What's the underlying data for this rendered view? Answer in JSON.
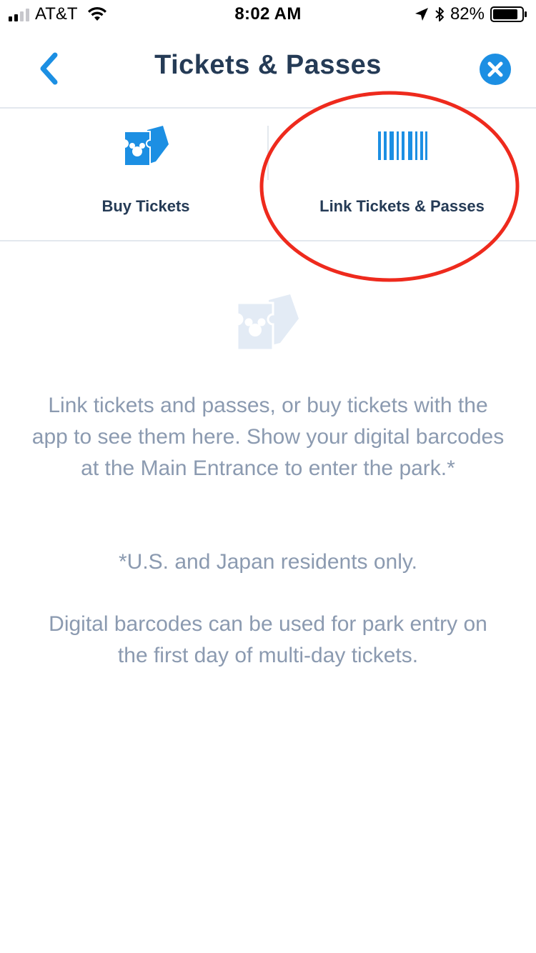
{
  "status_bar": {
    "carrier": "AT&T",
    "time": "8:02 AM",
    "battery": "82%",
    "icons": [
      "signal-icon",
      "wifi-icon",
      "location-arrow-icon",
      "bluetooth-icon",
      "battery-icon"
    ]
  },
  "nav": {
    "title": "Tickets & Passes",
    "back_icon": "chevron-left-icon",
    "close_icon": "close-circle-icon"
  },
  "tabs": [
    {
      "label": "Buy Tickets",
      "icon": "ticket-mickey-icon"
    },
    {
      "label": "Link Tickets & Passes",
      "icon": "barcode-icon"
    }
  ],
  "empty_state": {
    "icon": "ticket-mickey-icon",
    "main_text": "Link tickets and passes, or buy tickets with the app to see them here. Show your digital barcodes at the Main Entrance to enter the park.*",
    "note_text": "*U.S. and Japan residents only.",
    "digital_text": "Digital barcodes can be used for park entry on the first day of multi-day tickets."
  },
  "colors": {
    "accent": "#1c8fe3",
    "title": "#253b56",
    "body_text": "#8b9ab0",
    "empty_icon": "#e3ebf5",
    "annotation": "#ee2a1d",
    "divider": "#e3e8ee"
  }
}
